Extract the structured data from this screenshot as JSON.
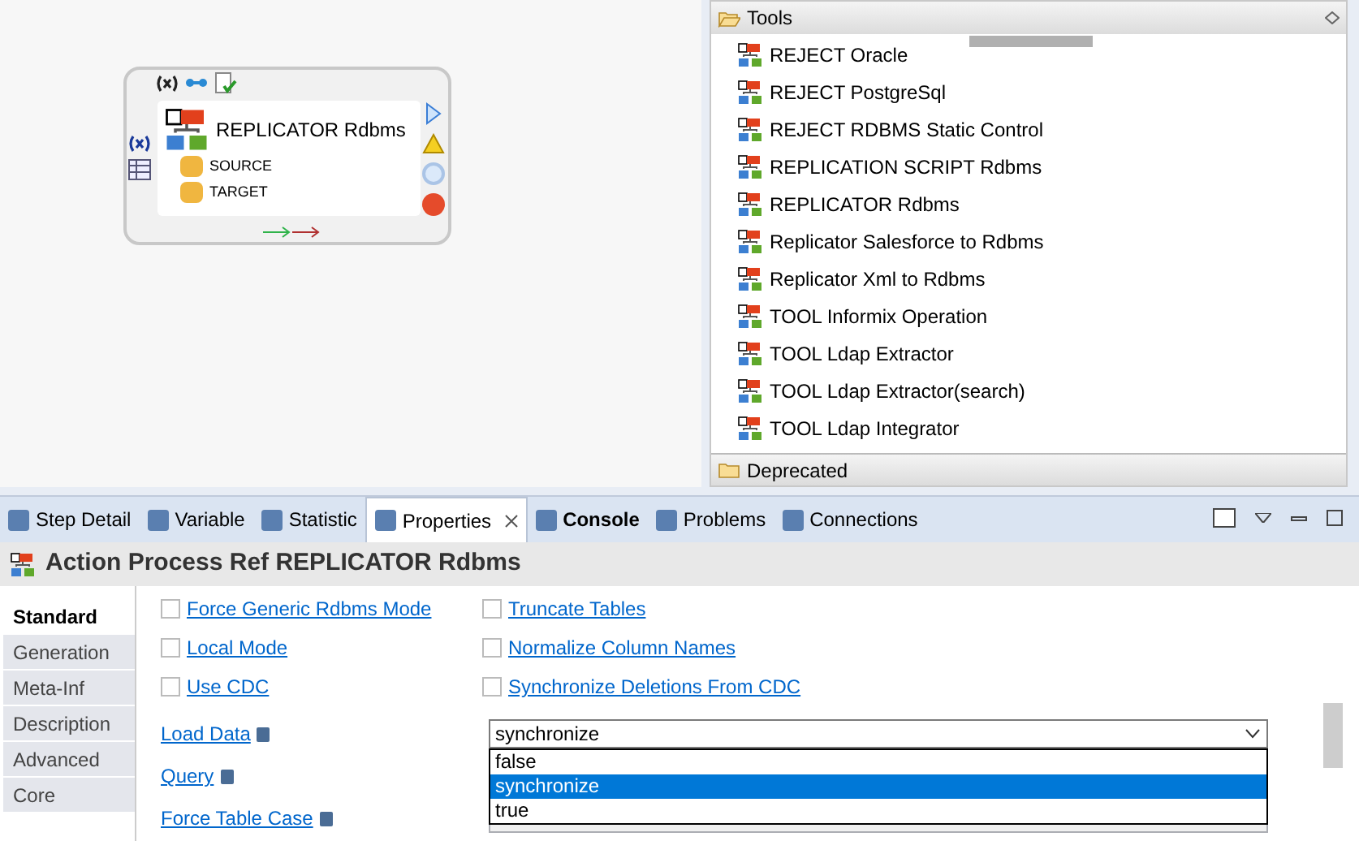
{
  "node": {
    "title": "REPLICATOR Rdbms",
    "ports": [
      "SOURCE",
      "TARGET"
    ]
  },
  "palette": {
    "groups": [
      {
        "label": "Tools",
        "expanded": true,
        "items": [
          "REJECT Oracle",
          "REJECT PostgreSql",
          "REJECT RDBMS Static Control",
          "REPLICATION SCRIPT Rdbms",
          "REPLICATOR Rdbms",
          "Replicator Salesforce to Rdbms",
          "Replicator Xml to Rdbms",
          "TOOL Informix Operation",
          "TOOL Ldap Extractor",
          "TOOL Ldap Extractor(search)",
          "TOOL Ldap Integrator"
        ]
      },
      {
        "label": "Deprecated",
        "expanded": false
      }
    ]
  },
  "tabs": [
    {
      "label": "Step Detail",
      "selected": false,
      "bold": false,
      "closable": false
    },
    {
      "label": "Variable",
      "selected": false,
      "bold": false,
      "closable": false
    },
    {
      "label": "Statistic",
      "selected": false,
      "bold": false,
      "closable": false
    },
    {
      "label": "Properties",
      "selected": true,
      "bold": false,
      "closable": true
    },
    {
      "label": "Console",
      "selected": false,
      "bold": true,
      "closable": false
    },
    {
      "label": "Problems",
      "selected": false,
      "bold": false,
      "closable": false
    },
    {
      "label": "Connections",
      "selected": false,
      "bold": false,
      "closable": false
    }
  ],
  "properties": {
    "title": "Action Process Ref REPLICATOR Rdbms",
    "sections": [
      {
        "label": "Standard",
        "selected": true
      },
      {
        "label": "Generation",
        "selected": false
      },
      {
        "label": "Meta-Inf",
        "selected": false
      },
      {
        "label": "Description",
        "selected": false
      },
      {
        "label": "Advanced",
        "selected": false
      },
      {
        "label": "Core",
        "selected": false
      }
    ],
    "checkboxes": [
      [
        {
          "label": "Force Generic Rdbms Mode",
          "checked": false
        },
        {
          "label": "Truncate Tables",
          "checked": false
        }
      ],
      [
        {
          "label": "Local Mode",
          "checked": false
        },
        {
          "label": "Normalize Column Names",
          "checked": false
        }
      ],
      [
        {
          "label": "Use CDC",
          "checked": false
        },
        {
          "label": "Synchronize Deletions From CDC",
          "checked": false
        }
      ]
    ],
    "fields": [
      {
        "label": "Load Data",
        "value": "synchronize",
        "open": true,
        "options": [
          {
            "label": "false",
            "selected": false
          },
          {
            "label": "synchronize",
            "selected": true
          },
          {
            "label": "true",
            "selected": false
          }
        ]
      },
      {
        "label": "Query"
      },
      {
        "label": "Force Table Case"
      }
    ]
  }
}
